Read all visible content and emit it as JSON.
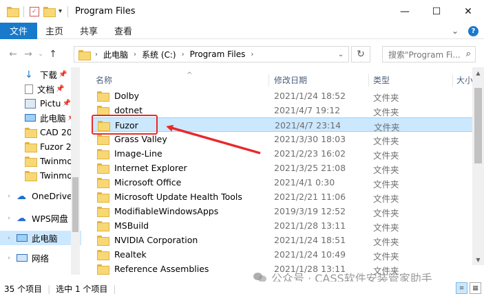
{
  "window": {
    "title": "Program Files",
    "minimize": "—",
    "maximize": "☐",
    "close": "✕"
  },
  "ribbon": {
    "tabs": [
      "文件",
      "主页",
      "共享",
      "查看"
    ],
    "chevron": "⌄"
  },
  "address": {
    "crumbs": [
      "此电脑",
      "系统 (C:)",
      "Program Files"
    ],
    "search_placeholder": "搜索\"Program Fi..."
  },
  "nav_pane": {
    "items": [
      {
        "label": "下载",
        "icon": "download-icon",
        "pinned": true
      },
      {
        "label": "文档",
        "icon": "document-icon",
        "pinned": true
      },
      {
        "label": "Pictu",
        "icon": "pictures-icon",
        "pinned": true
      },
      {
        "label": "此电脑",
        "icon": "computer-icon",
        "pinned": true
      },
      {
        "label": "CAD 20",
        "icon": "folder-icon",
        "pinned": false
      },
      {
        "label": "Fuzor 2(",
        "icon": "folder-icon",
        "pinned": false
      },
      {
        "label": "Twinmo",
        "icon": "folder-icon",
        "pinned": false
      },
      {
        "label": "Twinmo",
        "icon": "folder-icon",
        "pinned": false
      },
      {
        "label": "OneDrive",
        "icon": "cloud-icon",
        "pinned": false
      },
      {
        "label": "WPS网盘",
        "icon": "wps-cloud-icon",
        "pinned": false
      },
      {
        "label": "此电脑",
        "icon": "computer-icon",
        "pinned": false,
        "selected": true
      },
      {
        "label": "网络",
        "icon": "network-icon",
        "pinned": false
      }
    ]
  },
  "columns": {
    "name": "名称",
    "date": "修改日期",
    "type": "类型",
    "size": "大小"
  },
  "files": [
    {
      "name": "Dolby",
      "date": "2021/1/24 18:52",
      "type": "文件夹"
    },
    {
      "name": "dotnet",
      "date": "2021/4/7 19:12",
      "type": "文件夹"
    },
    {
      "name": "Fuzor",
      "date": "2021/4/7 23:14",
      "type": "文件夹",
      "selected": true
    },
    {
      "name": "Grass Valley",
      "date": "2021/3/30 18:03",
      "type": "文件夹"
    },
    {
      "name": "Image-Line",
      "date": "2021/2/23 16:02",
      "type": "文件夹"
    },
    {
      "name": "Internet Explorer",
      "date": "2021/3/25 21:08",
      "type": "文件夹"
    },
    {
      "name": "Microsoft Office",
      "date": "2021/4/1 0:30",
      "type": "文件夹"
    },
    {
      "name": "Microsoft Update Health Tools",
      "date": "2021/2/21 11:06",
      "type": "文件夹"
    },
    {
      "name": "ModifiableWindowsApps",
      "date": "2019/3/19 12:52",
      "type": "文件夹"
    },
    {
      "name": "MSBuild",
      "date": "2021/1/28 13:11",
      "type": "文件夹"
    },
    {
      "name": "NVIDIA Corporation",
      "date": "2021/1/24 18:51",
      "type": "文件夹"
    },
    {
      "name": "Realtek",
      "date": "2021/1/24 10:49",
      "type": "文件夹"
    },
    {
      "name": "Reference Assemblies",
      "date": "2021/1/28 13:11",
      "type": "文件夹"
    }
  ],
  "status": {
    "count": "35 个项目",
    "selection": "选中 1 个项目"
  },
  "watermark": "公众号 · CASS软件安装管家助手",
  "colors": {
    "accent": "#1979ca",
    "selection": "#cce8ff",
    "annotation": "#e8282b"
  }
}
